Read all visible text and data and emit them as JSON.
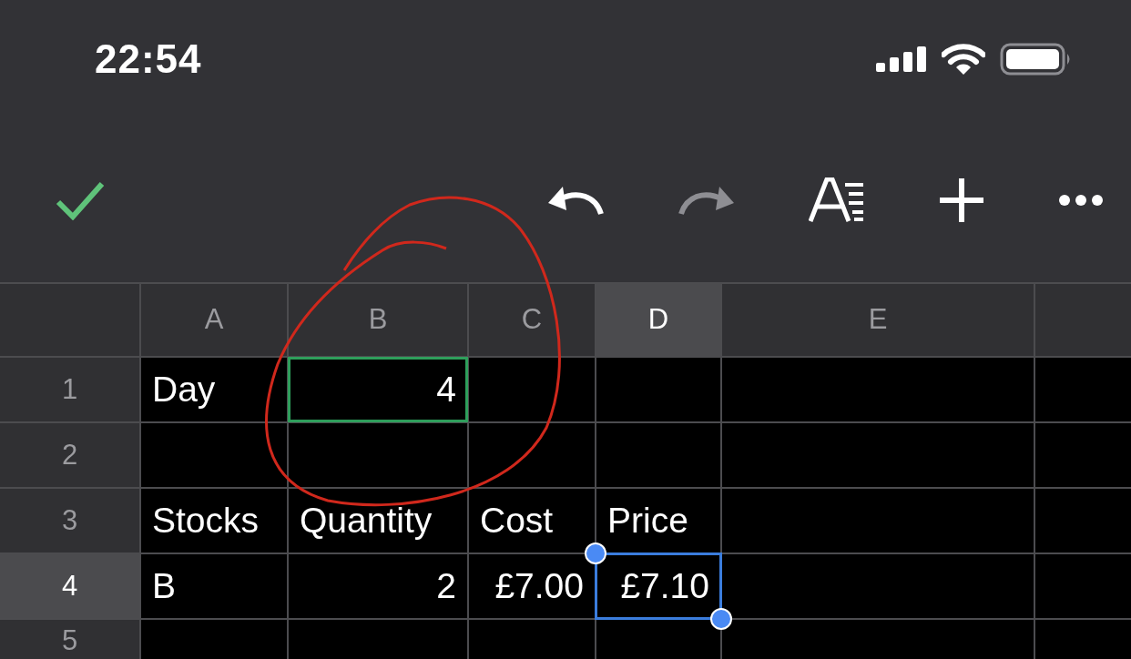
{
  "status_bar": {
    "time": "22:54"
  },
  "sheet": {
    "columns": [
      {
        "label": "A",
        "selected": false
      },
      {
        "label": "B",
        "selected": false
      },
      {
        "label": "C",
        "selected": false
      },
      {
        "label": "D",
        "selected": true
      },
      {
        "label": "E",
        "selected": false
      }
    ],
    "rows": [
      {
        "number": "1",
        "selected": false,
        "cells": [
          {
            "text": "Day",
            "kind": "text",
            "selected": false
          },
          {
            "text": "4",
            "kind": "number",
            "selected": false,
            "color": "#2e9e5b"
          }
        ]
      },
      {
        "number": "2",
        "selected": false
      },
      {
        "number": "3",
        "selected": false,
        "cells": [
          {
            "text": "Stocks",
            "kind": "text",
            "selected": false
          },
          {
            "text": "Quantity",
            "kind": "text",
            "selected": false
          },
          {
            "text": "Cost",
            "kind": "text",
            "selected": false
          },
          {
            "text": "Price",
            "kind": "text",
            "selected": false
          }
        ]
      },
      {
        "number": "4",
        "selected": true,
        "cells": [
          {
            "text": "B",
            "kind": "text",
            "selected": false
          },
          {
            "text": "2",
            "kind": "number",
            "selected": false
          },
          {
            "text": "£7.00",
            "kind": "number",
            "selected": false
          },
          {
            "text": "£7.10",
            "kind": "number",
            "selected": true
          }
        ]
      },
      {
        "number": "5",
        "selected": false
      }
    ]
  }
}
